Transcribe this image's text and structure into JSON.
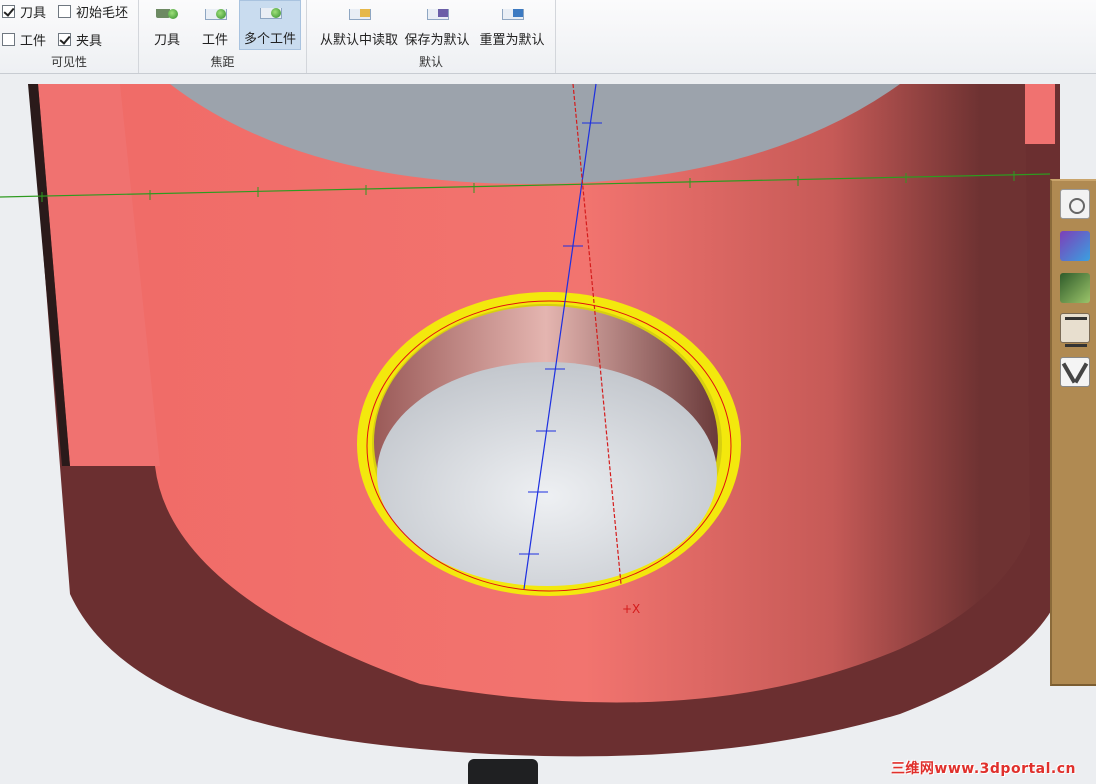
{
  "ribbon": {
    "visibility": {
      "label": "可见性",
      "checkboxes": [
        {
          "label": "刀具",
          "checked": true
        },
        {
          "label": "初始毛坯",
          "checked": false
        },
        {
          "label": "工件",
          "checked": false
        },
        {
          "label": "夹具",
          "checked": true
        }
      ]
    },
    "focus": {
      "label": "焦距",
      "buttons": [
        {
          "label": "刀具",
          "active": false
        },
        {
          "label": "工件",
          "active": false
        },
        {
          "label": "多个工件",
          "active": true
        }
      ]
    },
    "default": {
      "label": "默认",
      "buttons": [
        {
          "label": "从默认中读取"
        },
        {
          "label": "保存为默认"
        },
        {
          "label": "重置为默认"
        }
      ]
    }
  },
  "viewport": {
    "marker": "+X",
    "colors": {
      "part_face": "#f2706c",
      "part_dark": "#6b2f30",
      "hole_edge": "#f3e80d",
      "axis_x": "#2e9a20",
      "axis_y": "#1d2fe0",
      "axis_z": "#d41c1c"
    }
  },
  "side_toolbar": {
    "icons": [
      "camera-icon",
      "bird-icon",
      "photo-icon",
      "calligraphy-icon",
      "x-logo-icon"
    ]
  },
  "watermark": "三维网www.3dportal.cn"
}
